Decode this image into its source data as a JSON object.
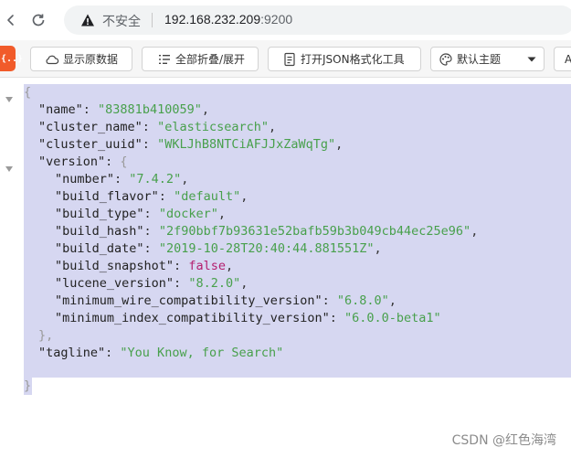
{
  "browser": {
    "security_label": "不安全",
    "url_host": "192.168.232.209",
    "url_port": ":9200"
  },
  "toolbar": {
    "extension_badge": "{..}",
    "show_raw_label": "显示原数据",
    "fold_label": "全部折叠/展开",
    "format_label": "打开JSON格式化工具",
    "theme_label": "默认主题",
    "next_label": "A"
  },
  "json": {
    "open_brace": "{",
    "close_brace": "}",
    "fields": [
      {
        "key": "\"name\"",
        "value": "\"83881b410059\"",
        "type": "string",
        "comma": ","
      },
      {
        "key": "\"cluster_name\"",
        "value": "\"elasticsearch\"",
        "type": "string",
        "comma": ","
      },
      {
        "key": "\"cluster_uuid\"",
        "value": "\"WKLJhB8NTCiAFJJxZaWqTg\"",
        "type": "string",
        "comma": ","
      }
    ],
    "version_key": "\"version\"",
    "version_fields": [
      {
        "key": "\"number\"",
        "value": "\"7.4.2\"",
        "type": "string",
        "comma": ","
      },
      {
        "key": "\"build_flavor\"",
        "value": "\"default\"",
        "type": "string",
        "comma": ","
      },
      {
        "key": "\"build_type\"",
        "value": "\"docker\"",
        "type": "string",
        "comma": ","
      },
      {
        "key": "\"build_hash\"",
        "value": "\"2f90bbf7b93631e52bafb59b3b049cb44ec25e96\"",
        "type": "string",
        "comma": ","
      },
      {
        "key": "\"build_date\"",
        "value": "\"2019-10-28T20:40:44.881551Z\"",
        "type": "string",
        "comma": ","
      },
      {
        "key": "\"build_snapshot\"",
        "value": "false",
        "type": "bool",
        "comma": ","
      },
      {
        "key": "\"lucene_version\"",
        "value": "\"8.2.0\"",
        "type": "string",
        "comma": ","
      },
      {
        "key": "\"minimum_wire_compatibility_version\"",
        "value": "\"6.8.0\"",
        "type": "string",
        "comma": ","
      },
      {
        "key": "\"minimum_index_compatibility_version\"",
        "value": "\"6.0.0-beta1\"",
        "type": "string",
        "comma": ""
      }
    ],
    "version_close": "},",
    "tagline_key": "\"tagline\"",
    "tagline_value": "\"You Know, for Search\""
  },
  "watermark": "CSDN @红色海湾"
}
